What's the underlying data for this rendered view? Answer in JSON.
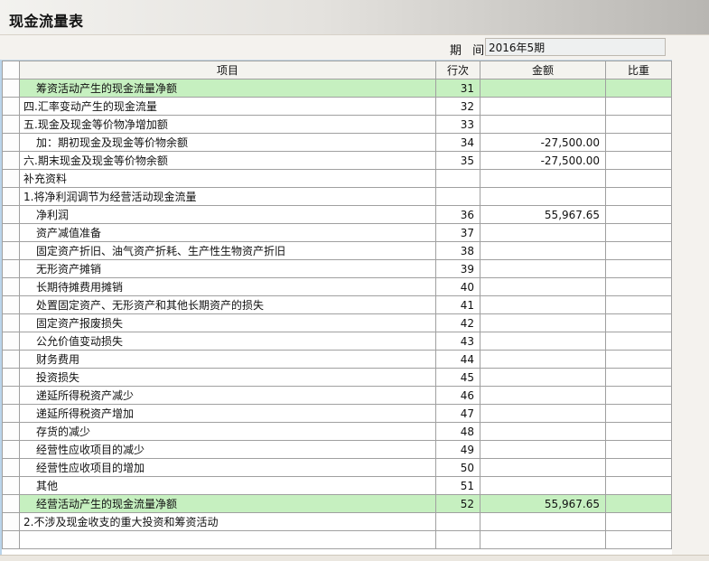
{
  "window": {
    "title": "现金流量表"
  },
  "period": {
    "label": "期 间",
    "value": "2016年5期"
  },
  "table": {
    "columns": [
      "项目",
      "行次",
      "金额",
      "比重"
    ],
    "rows": [
      {
        "item": "筹资活动产生的现金流量净额",
        "line": "31",
        "amount": "",
        "ratio": "",
        "indent": true,
        "highlight": true
      },
      {
        "item": "四.汇率变动产生的现金流量",
        "line": "32",
        "amount": "",
        "ratio": "",
        "indent": false,
        "highlight": false
      },
      {
        "item": "五.现金及现金等价物净增加额",
        "line": "33",
        "amount": "",
        "ratio": "",
        "indent": false,
        "highlight": false
      },
      {
        "item": "加：期初现金及现金等价物余额",
        "line": "34",
        "amount": "-27,500.00",
        "ratio": "",
        "indent": true,
        "highlight": false
      },
      {
        "item": "六.期末现金及现金等价物余额",
        "line": "35",
        "amount": "-27,500.00",
        "ratio": "",
        "indent": false,
        "highlight": false
      },
      {
        "item": "补充资料",
        "line": "",
        "amount": "",
        "ratio": "",
        "indent": false,
        "highlight": false
      },
      {
        "item": "1.将净利润调节为经营活动现金流量",
        "line": "",
        "amount": "",
        "ratio": "",
        "indent": false,
        "highlight": false
      },
      {
        "item": "净利润",
        "line": "36",
        "amount": "55,967.65",
        "ratio": "",
        "indent": true,
        "highlight": false
      },
      {
        "item": "资产减值准备",
        "line": "37",
        "amount": "",
        "ratio": "",
        "indent": true,
        "highlight": false
      },
      {
        "item": "固定资产折旧、油气资产折耗、生产性生物资产折旧",
        "line": "38",
        "amount": "",
        "ratio": "",
        "indent": true,
        "highlight": false
      },
      {
        "item": "无形资产摊销",
        "line": "39",
        "amount": "",
        "ratio": "",
        "indent": true,
        "highlight": false
      },
      {
        "item": "长期待摊费用摊销",
        "line": "40",
        "amount": "",
        "ratio": "",
        "indent": true,
        "highlight": false
      },
      {
        "item": "处置固定资产、无形资产和其他长期资产的损失",
        "line": "41",
        "amount": "",
        "ratio": "",
        "indent": true,
        "highlight": false
      },
      {
        "item": "固定资产报废损失",
        "line": "42",
        "amount": "",
        "ratio": "",
        "indent": true,
        "highlight": false
      },
      {
        "item": "公允价值变动损失",
        "line": "43",
        "amount": "",
        "ratio": "",
        "indent": true,
        "highlight": false
      },
      {
        "item": "财务费用",
        "line": "44",
        "amount": "",
        "ratio": "",
        "indent": true,
        "highlight": false
      },
      {
        "item": "投资损失",
        "line": "45",
        "amount": "",
        "ratio": "",
        "indent": true,
        "highlight": false
      },
      {
        "item": "递延所得税资产减少",
        "line": "46",
        "amount": "",
        "ratio": "",
        "indent": true,
        "highlight": false
      },
      {
        "item": "递延所得税资产增加",
        "line": "47",
        "amount": "",
        "ratio": "",
        "indent": true,
        "highlight": false
      },
      {
        "item": "存货的减少",
        "line": "48",
        "amount": "",
        "ratio": "",
        "indent": true,
        "highlight": false
      },
      {
        "item": "经营性应收项目的减少",
        "line": "49",
        "amount": "",
        "ratio": "",
        "indent": true,
        "highlight": false
      },
      {
        "item": "经营性应收项目的增加",
        "line": "50",
        "amount": "",
        "ratio": "",
        "indent": true,
        "highlight": false
      },
      {
        "item": "其他",
        "line": "51",
        "amount": "",
        "ratio": "",
        "indent": true,
        "highlight": false
      },
      {
        "item": "经营活动产生的现金流量净额",
        "line": "52",
        "amount": "55,967.65",
        "ratio": "",
        "indent": true,
        "highlight": true
      },
      {
        "item": "2.不涉及现金收支的重大投资和筹资活动",
        "line": "",
        "amount": "",
        "ratio": "",
        "indent": false,
        "highlight": false
      },
      {
        "item": "",
        "line": "",
        "amount": "",
        "ratio": "",
        "indent": false,
        "highlight": false
      }
    ]
  },
  "colors": {
    "highlight_row": "#c6f0c0",
    "grid_border": "#a0a0a0"
  }
}
